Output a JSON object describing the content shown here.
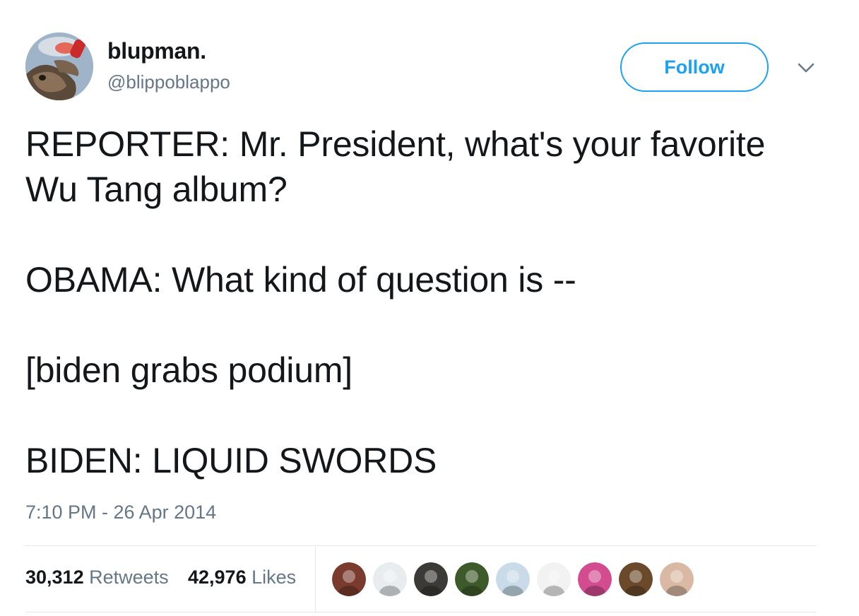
{
  "author": {
    "display_name": "blupman.",
    "handle": "@blippoblappo",
    "avatar_icon": "profile-avatar"
  },
  "actions": {
    "follow_label": "Follow",
    "menu_icon": "chevron-down-icon"
  },
  "tweet": {
    "lines": [
      "REPORTER: Mr. President, what's your favorite Wu Tang album?",
      "OBAMA: What kind of question is --",
      "[biden grabs podium]",
      "BIDEN: LIQUID SWORDS"
    ],
    "timestamp": "7:10 PM - 26 Apr 2014"
  },
  "stats": {
    "retweets_count": "30,312",
    "retweets_label": "Retweets",
    "likes_count": "42,976",
    "likes_label": "Likes"
  },
  "likers": [
    {
      "name": "liker-avatar-1",
      "color": "#7a3b2e"
    },
    {
      "name": "liker-avatar-2",
      "color": "#e8ecef"
    },
    {
      "name": "liker-avatar-3",
      "color": "#3b3a36"
    },
    {
      "name": "liker-avatar-4",
      "color": "#3f5a2a"
    },
    {
      "name": "liker-avatar-5",
      "color": "#c9dbe8"
    },
    {
      "name": "liker-avatar-6",
      "color": "#f2f2f2"
    },
    {
      "name": "liker-avatar-7",
      "color": "#d24c8f"
    },
    {
      "name": "liker-avatar-8",
      "color": "#6b4a2c"
    },
    {
      "name": "liker-avatar-9",
      "color": "#d9b9a3"
    }
  ],
  "colors": {
    "accent": "#1da1f2",
    "text_primary": "#14171a",
    "text_secondary": "#657786",
    "divider": "#e1e8ed"
  }
}
